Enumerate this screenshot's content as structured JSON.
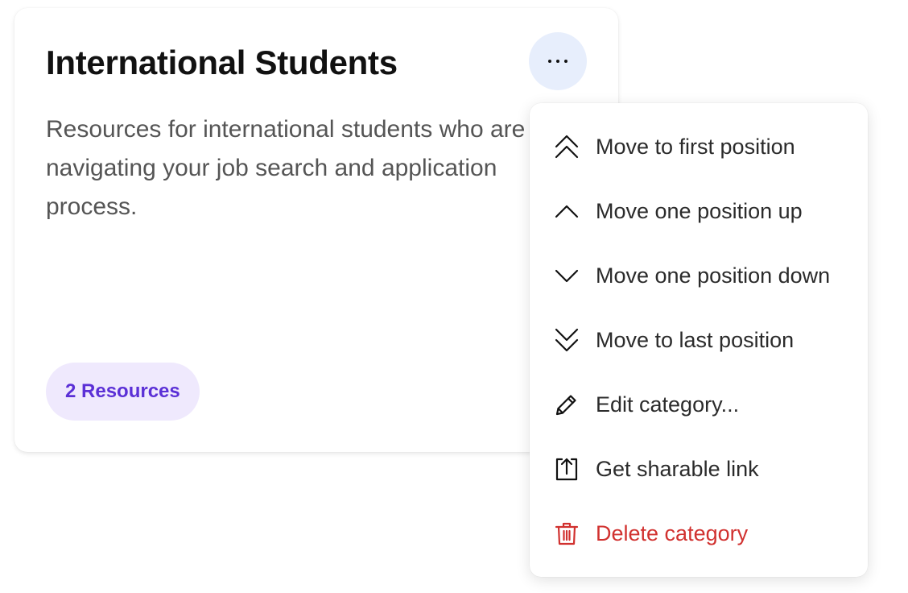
{
  "card": {
    "title": "International Students",
    "description": "Resources for international students who are navigating your job search and application process.",
    "resources_badge": "2 Resources"
  },
  "more_button": {
    "icon": "more-horizontal-icon"
  },
  "menu": {
    "items": [
      {
        "label": "Move to first position",
        "icon": "chevrons-up-icon"
      },
      {
        "label": "Move one position up",
        "icon": "chevron-up-icon"
      },
      {
        "label": "Move one position down",
        "icon": "chevron-down-icon"
      },
      {
        "label": "Move to last position",
        "icon": "chevrons-down-icon"
      },
      {
        "label": "Edit category...",
        "icon": "pencil-icon"
      },
      {
        "label": "Get sharable link",
        "icon": "share-icon"
      },
      {
        "label": "Delete category",
        "icon": "trash-icon",
        "color": "#d1312f"
      }
    ]
  },
  "colors": {
    "badge_bg": "#efe9fd",
    "badge_text": "#5b30d6",
    "more_button_bg": "#e7eefc",
    "danger": "#d1312f"
  }
}
